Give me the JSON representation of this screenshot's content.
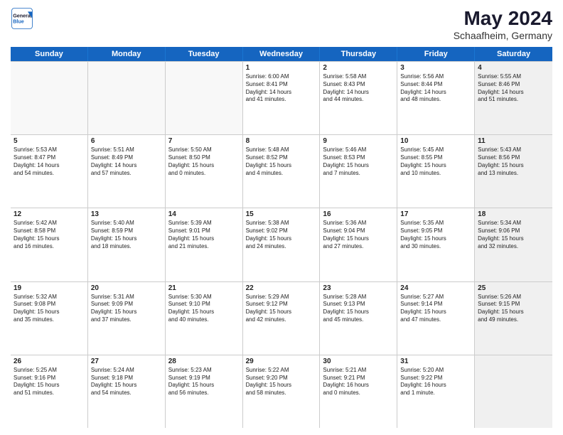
{
  "header": {
    "logo_line1": "General",
    "logo_line2": "Blue",
    "main_title": "May 2024",
    "subtitle": "Schaafheim, Germany"
  },
  "days_of_week": [
    "Sunday",
    "Monday",
    "Tuesday",
    "Wednesday",
    "Thursday",
    "Friday",
    "Saturday"
  ],
  "rows": [
    [
      {
        "num": "",
        "text": "",
        "empty": true
      },
      {
        "num": "",
        "text": "",
        "empty": true
      },
      {
        "num": "",
        "text": "",
        "empty": true
      },
      {
        "num": "1",
        "text": "Sunrise: 6:00 AM\nSunset: 8:41 PM\nDaylight: 14 hours\nand 41 minutes."
      },
      {
        "num": "2",
        "text": "Sunrise: 5:58 AM\nSunset: 8:43 PM\nDaylight: 14 hours\nand 44 minutes."
      },
      {
        "num": "3",
        "text": "Sunrise: 5:56 AM\nSunset: 8:44 PM\nDaylight: 14 hours\nand 48 minutes."
      },
      {
        "num": "4",
        "text": "Sunrise: 5:55 AM\nSunset: 8:46 PM\nDaylight: 14 hours\nand 51 minutes.",
        "shaded": true
      }
    ],
    [
      {
        "num": "5",
        "text": "Sunrise: 5:53 AM\nSunset: 8:47 PM\nDaylight: 14 hours\nand 54 minutes."
      },
      {
        "num": "6",
        "text": "Sunrise: 5:51 AM\nSunset: 8:49 PM\nDaylight: 14 hours\nand 57 minutes."
      },
      {
        "num": "7",
        "text": "Sunrise: 5:50 AM\nSunset: 8:50 PM\nDaylight: 15 hours\nand 0 minutes."
      },
      {
        "num": "8",
        "text": "Sunrise: 5:48 AM\nSunset: 8:52 PM\nDaylight: 15 hours\nand 4 minutes."
      },
      {
        "num": "9",
        "text": "Sunrise: 5:46 AM\nSunset: 8:53 PM\nDaylight: 15 hours\nand 7 minutes."
      },
      {
        "num": "10",
        "text": "Sunrise: 5:45 AM\nSunset: 8:55 PM\nDaylight: 15 hours\nand 10 minutes."
      },
      {
        "num": "11",
        "text": "Sunrise: 5:43 AM\nSunset: 8:56 PM\nDaylight: 15 hours\nand 13 minutes.",
        "shaded": true
      }
    ],
    [
      {
        "num": "12",
        "text": "Sunrise: 5:42 AM\nSunset: 8:58 PM\nDaylight: 15 hours\nand 16 minutes."
      },
      {
        "num": "13",
        "text": "Sunrise: 5:40 AM\nSunset: 8:59 PM\nDaylight: 15 hours\nand 18 minutes."
      },
      {
        "num": "14",
        "text": "Sunrise: 5:39 AM\nSunset: 9:01 PM\nDaylight: 15 hours\nand 21 minutes."
      },
      {
        "num": "15",
        "text": "Sunrise: 5:38 AM\nSunset: 9:02 PM\nDaylight: 15 hours\nand 24 minutes."
      },
      {
        "num": "16",
        "text": "Sunrise: 5:36 AM\nSunset: 9:04 PM\nDaylight: 15 hours\nand 27 minutes."
      },
      {
        "num": "17",
        "text": "Sunrise: 5:35 AM\nSunset: 9:05 PM\nDaylight: 15 hours\nand 30 minutes."
      },
      {
        "num": "18",
        "text": "Sunrise: 5:34 AM\nSunset: 9:06 PM\nDaylight: 15 hours\nand 32 minutes.",
        "shaded": true
      }
    ],
    [
      {
        "num": "19",
        "text": "Sunrise: 5:32 AM\nSunset: 9:08 PM\nDaylight: 15 hours\nand 35 minutes."
      },
      {
        "num": "20",
        "text": "Sunrise: 5:31 AM\nSunset: 9:09 PM\nDaylight: 15 hours\nand 37 minutes."
      },
      {
        "num": "21",
        "text": "Sunrise: 5:30 AM\nSunset: 9:10 PM\nDaylight: 15 hours\nand 40 minutes."
      },
      {
        "num": "22",
        "text": "Sunrise: 5:29 AM\nSunset: 9:12 PM\nDaylight: 15 hours\nand 42 minutes."
      },
      {
        "num": "23",
        "text": "Sunrise: 5:28 AM\nSunset: 9:13 PM\nDaylight: 15 hours\nand 45 minutes."
      },
      {
        "num": "24",
        "text": "Sunrise: 5:27 AM\nSunset: 9:14 PM\nDaylight: 15 hours\nand 47 minutes."
      },
      {
        "num": "25",
        "text": "Sunrise: 5:26 AM\nSunset: 9:15 PM\nDaylight: 15 hours\nand 49 minutes.",
        "shaded": true
      }
    ],
    [
      {
        "num": "26",
        "text": "Sunrise: 5:25 AM\nSunset: 9:16 PM\nDaylight: 15 hours\nand 51 minutes."
      },
      {
        "num": "27",
        "text": "Sunrise: 5:24 AM\nSunset: 9:18 PM\nDaylight: 15 hours\nand 54 minutes."
      },
      {
        "num": "28",
        "text": "Sunrise: 5:23 AM\nSunset: 9:19 PM\nDaylight: 15 hours\nand 56 minutes."
      },
      {
        "num": "29",
        "text": "Sunrise: 5:22 AM\nSunset: 9:20 PM\nDaylight: 15 hours\nand 58 minutes."
      },
      {
        "num": "30",
        "text": "Sunrise: 5:21 AM\nSunset: 9:21 PM\nDaylight: 16 hours\nand 0 minutes."
      },
      {
        "num": "31",
        "text": "Sunrise: 5:20 AM\nSunset: 9:22 PM\nDaylight: 16 hours\nand 1 minute."
      },
      {
        "num": "",
        "text": "",
        "empty": true,
        "shaded": true
      }
    ]
  ]
}
